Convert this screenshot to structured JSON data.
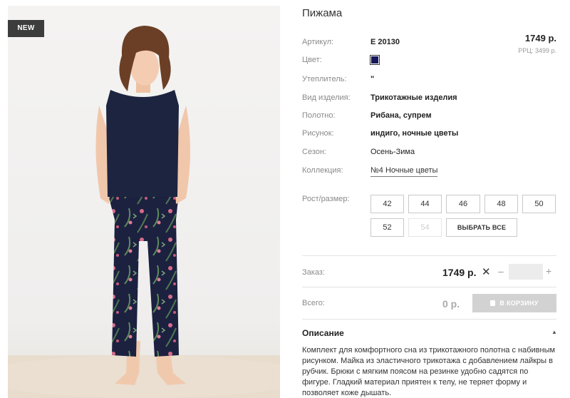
{
  "product": {
    "badge": "NEW",
    "title": "Пижама",
    "price": "1749 р.",
    "rrc": "РРЦ: 3499 р."
  },
  "attributes": {
    "article": {
      "label": "Артикул:",
      "value": "Е 20130"
    },
    "color": {
      "label": "Цвет:",
      "swatch_hex": "#17175c"
    },
    "insulation": {
      "label": "Утеплитель:",
      "value": "\""
    },
    "type": {
      "label": "Вид изделия:",
      "value": "Трикотажные изделия"
    },
    "fabric": {
      "label": "Полотно:",
      "value": "Рибана, супрем"
    },
    "pattern": {
      "label": "Рисунок:",
      "value": "индиго, ночные цветы"
    },
    "season": {
      "label": "Сезон:",
      "value": "Осень-Зима"
    },
    "collection": {
      "label": "Коллекция:",
      "value": "№4 Ночные цветы"
    }
  },
  "sizes": {
    "label": "Рост/размер:",
    "options": [
      "42",
      "44",
      "46",
      "48",
      "50",
      "52",
      "54"
    ],
    "disabled": [
      "54"
    ],
    "select_all": "ВЫБРАТЬ ВСЕ"
  },
  "order": {
    "label": "Заказ:",
    "price": "1749 р.",
    "clear_icon": "close-icon",
    "minus": "–",
    "plus": "+",
    "quantity": ""
  },
  "total": {
    "label": "Всего:",
    "value": "0 р.",
    "cart_button": "В КОРЗИНУ"
  },
  "description": {
    "title": "Описание",
    "text": "Комплект для комфортного сна из трикотажного полотна с набивным рисунком. Майка из эластичного трикотажа с добавлением лайкры в рубчик. Брюки с мягким поясом на резинке удобно садятся по фигуре. Гладкий материал приятен к телу, не теряет форму и позволяет коже дышать."
  },
  "colors": {
    "badge_bg": "#3d3d3d",
    "cart_disabled": "#d2d2d2",
    "swatch": "#17175c"
  }
}
